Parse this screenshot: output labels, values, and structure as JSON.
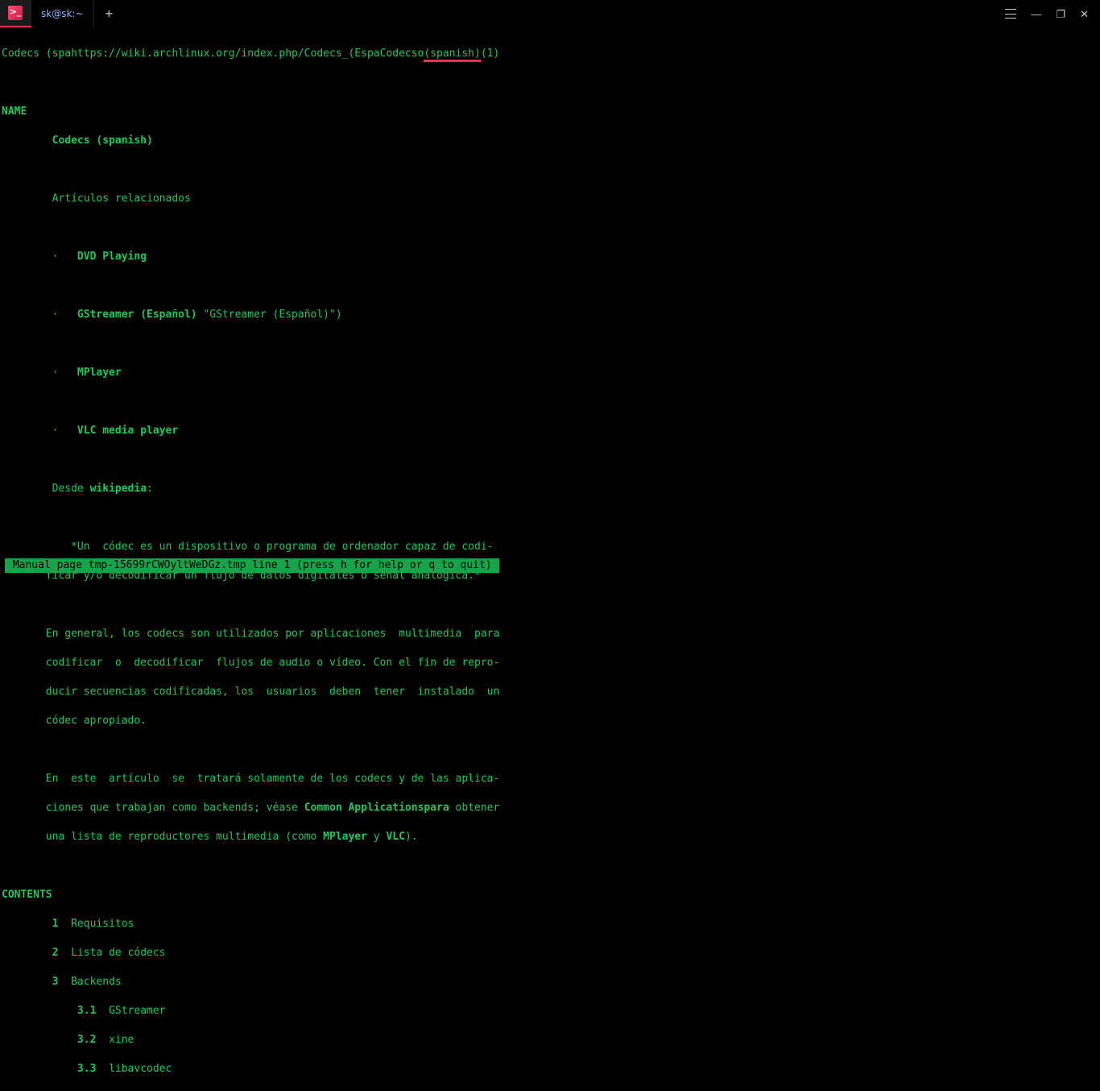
{
  "titlebar": {
    "tab_label": "sk@sk:~",
    "menu_icon": "hamburger-icon",
    "minimize": "—",
    "maximize": "❐",
    "close": "✕",
    "app_glyph": ">_"
  },
  "header_line": {
    "left": "Codecs (spahttps://wiki.archlinux.org/index.php/Codecs_(EspaCodecso",
    "underlined": "(spanish)",
    "right": "(1)"
  },
  "sections": {
    "name_heading": "NAME",
    "name_title": "Codecs (spanish)",
    "related": "Artículos relacionados",
    "bullets": [
      {
        "b": "DVD Playing",
        "rest": ""
      },
      {
        "b": "GStreamer (Español)",
        "rest": " \"GStreamer (Español)\")"
      },
      {
        "b": "MPlayer",
        "rest": ""
      },
      {
        "b": "VLC media player",
        "rest": ""
      }
    ],
    "desde_pre": "Desde ",
    "desde_bold": "wikipedia",
    "desde_post": ":",
    "def_l1": "           *Un  códec es un dispositivo o programa de ordenador capaz de codi-",
    "def_l2": "       ficar y/o decodificar un flujo de datos digitales o señal analógica.*",
    "para1_l1": "       En general, los codecs son utilizados por aplicaciones  multimedia  para",
    "para1_l2": "       codificar  o  decodificar  flujos de audio o vídeo. Con el fin de repro-",
    "para1_l3": "       ducir secuencias codificadas, los  usuarios  deben  tener  instalado  un",
    "para1_l4": "       códec apropiado.",
    "para2_l1": "       En  este  artículo  se  tratará solamente de los codecs y de las aplica-",
    "para2_pre": "       ciones que trabajan como backends; véase ",
    "para2_bold": "Common Applicationspara",
    "para2_post": " obtener",
    "para2_l3a": "       una lista de reproductores multimedia (como ",
    "para2_mbold": "MPlayer",
    "para2_mand": " y ",
    "para2_vbold": "VLC",
    "para2_l3b": ").",
    "contents_heading": "CONTENTS",
    "toc": [
      {
        "n": "1",
        "t": "Requisitos"
      },
      {
        "n": "2",
        "t": "Lista de códecs"
      },
      {
        "n": "3",
        "t": "Backends"
      }
    ],
    "toc_sub": [
      {
        "n": "3.1",
        "t": "GStreamer"
      },
      {
        "n": "3.2",
        "t": "xine"
      },
      {
        "n": "3.3",
        "t": "libavcodec"
      }
    ]
  },
  "status": " Manual page tmp-15699rCWOyltWeDGz.tmp line 1 (press h for help or q to quit) "
}
